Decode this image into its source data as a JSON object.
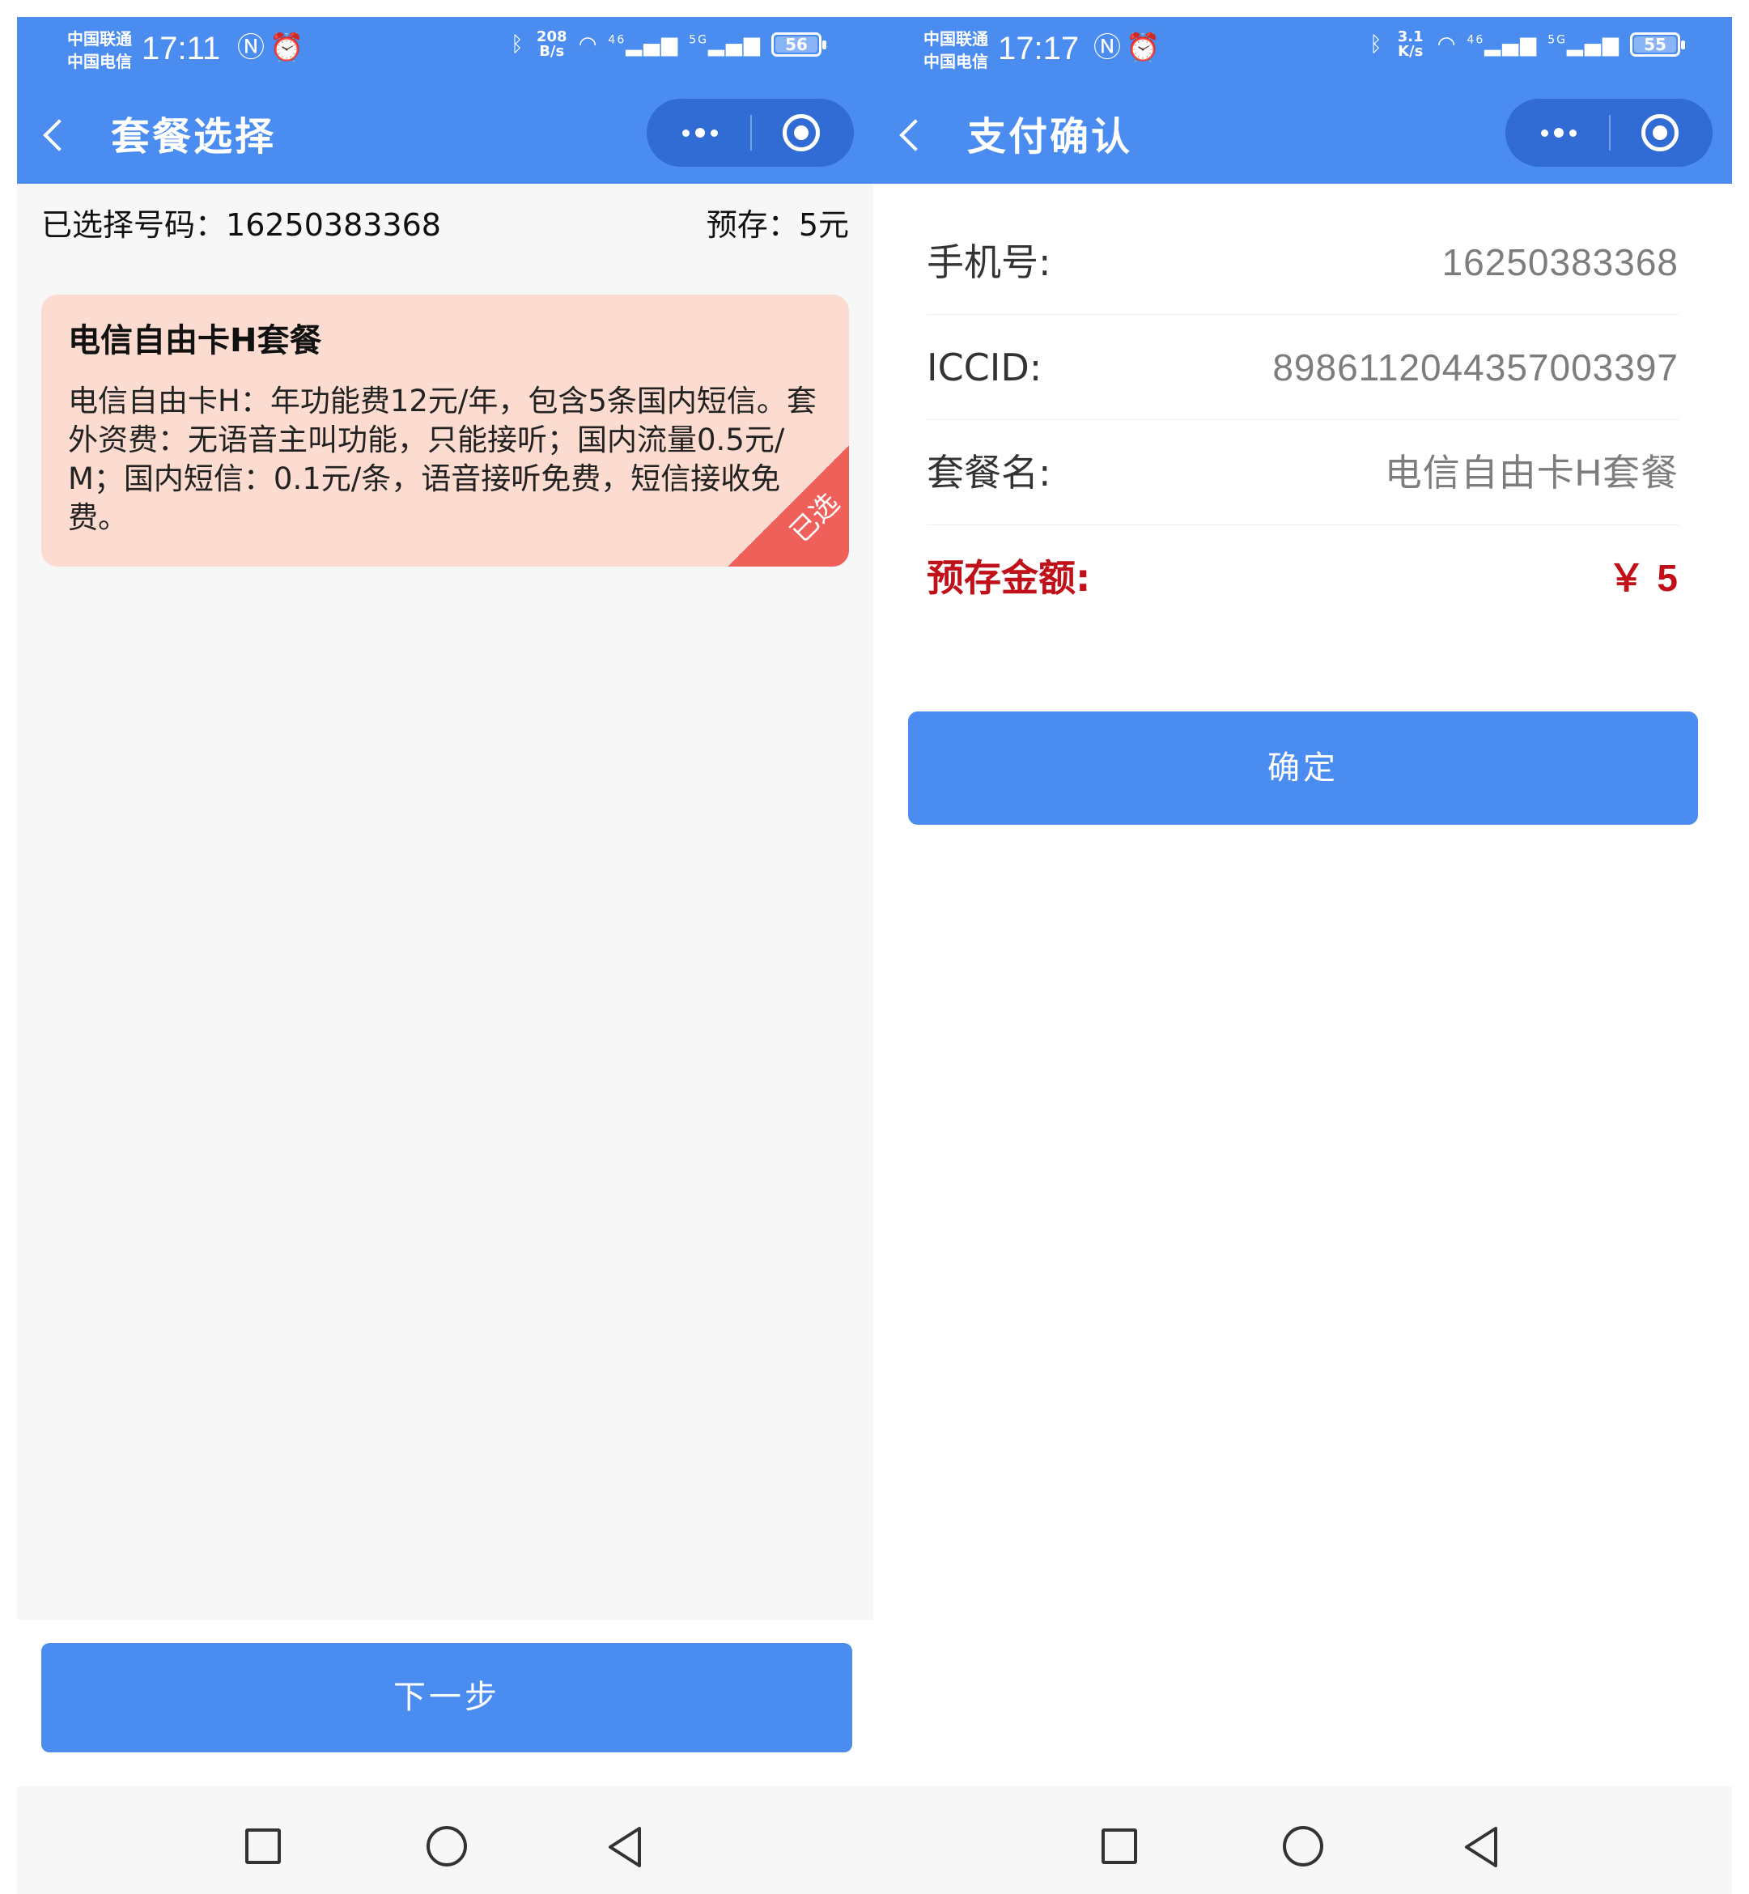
{
  "left": {
    "status": {
      "carrier_1": "中国联通",
      "carrier_2": "中国电信",
      "time": "17:11",
      "net_speed_value": "208",
      "net_speed_unit": "B/s",
      "signal_1": "46",
      "signal_2": "5G",
      "battery": "56"
    },
    "nav": {
      "title": "套餐选择"
    },
    "summary": {
      "number_label": "已选择号码：",
      "number_value": "16250383368",
      "deposit_label": "预存：",
      "deposit_value": "5元"
    },
    "plan_card": {
      "title": "电信自由卡H套餐",
      "description": "电信自由卡H：年功能费12元/年，包含5条国内短信。套外资费：无语音主叫功能，只能接听；国内流量0.5元/M；国内短信：0.1元/条，语音接听免费，短信接收免费。",
      "badge": "已选",
      "selected": true
    },
    "next_button": "下一步"
  },
  "right": {
    "status": {
      "carrier_1": "中国联通",
      "carrier_2": "中国电信",
      "time": "17:17",
      "net_speed_value": "3.1",
      "net_speed_unit": "K/s",
      "signal_1": "46",
      "signal_2": "5G",
      "battery": "55"
    },
    "nav": {
      "title": "支付确认"
    },
    "rows": [
      {
        "label": "手机号:",
        "value": "16250383368"
      },
      {
        "label": "ICCID:",
        "value": "89861120443570033​97"
      },
      {
        "label": "套餐名:",
        "value": "电信自由卡H套餐"
      },
      {
        "label": "预存金额:",
        "value": "￥ 5"
      }
    ],
    "confirm_button": "确定"
  },
  "icons": {
    "back": "back-chevron-icon",
    "more": "more-dots-icon",
    "close": "capsule-close-icon",
    "recent": "recent-apps-icon",
    "home": "home-icon",
    "system_back": "system-back-icon"
  },
  "colors": {
    "primary": "#4a8cf0",
    "card_bg": "#fcdcd0",
    "badge": "#f0605a",
    "highlight": "#c0101a"
  }
}
